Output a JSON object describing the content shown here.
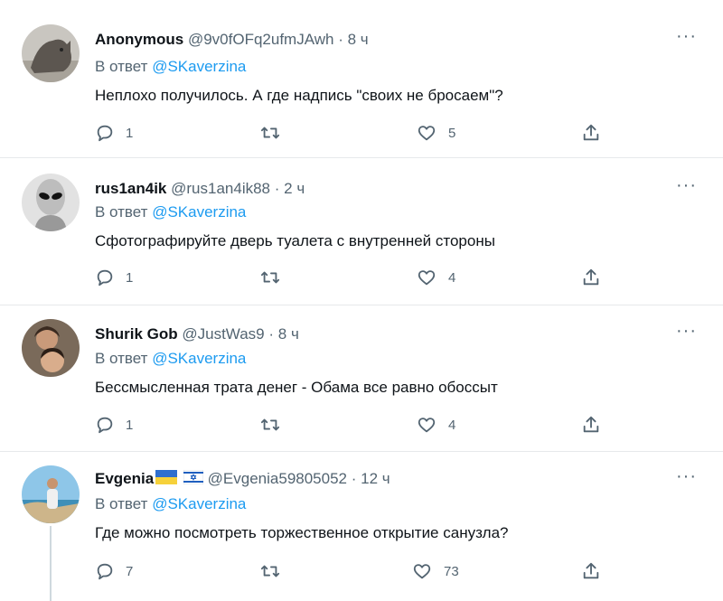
{
  "tweets": [
    {
      "name": "Anonymous",
      "handle": "@9v0fOFq2ufmJAwh",
      "dot": "·",
      "time": "8 ч",
      "reply_prefix": "В ответ",
      "reply_to": "@SKaverzina",
      "text": "Неплохо получилось. А где надпись \"своих не бросаем\"?",
      "replies": "1",
      "retweets": "",
      "likes": "5",
      "avatar": "cat-avatar"
    },
    {
      "name": "rus1an4ik",
      "handle": "@rus1an4ik88",
      "dot": "·",
      "time": "2 ч",
      "reply_prefix": "В ответ",
      "reply_to": "@SKaverzina",
      "text": "Сфотографируйте дверь туалета с внутренней стороны",
      "replies": "1",
      "retweets": "",
      "likes": "4",
      "avatar": "alien-avatar"
    },
    {
      "name": "Shurik Gob",
      "handle": "@JustWas9",
      "dot": "·",
      "time": "8 ч",
      "reply_prefix": "В ответ",
      "reply_to": "@SKaverzina",
      "text": "Бессмысленная трата денег - Обама все равно обоссыт",
      "replies": "1",
      "retweets": "",
      "likes": "4",
      "avatar": "photo-avatar"
    },
    {
      "name": "Evgenia",
      "handle": "@Evgenia59805052",
      "dot": "·",
      "time": "12 ч",
      "reply_prefix": "В ответ",
      "reply_to": "@SKaverzina",
      "text": "Где можно посмотреть торжественное открытие санузла?",
      "replies": "7",
      "retweets": "",
      "likes": "73",
      "avatar": "beach-avatar",
      "flags": [
        "ukraine-flag",
        "israel-flag"
      ]
    }
  ],
  "colors": {
    "text": "#0f1419",
    "secondary": "#536471",
    "mention": "#1d9bf0",
    "divider": "#e6e9eb"
  }
}
